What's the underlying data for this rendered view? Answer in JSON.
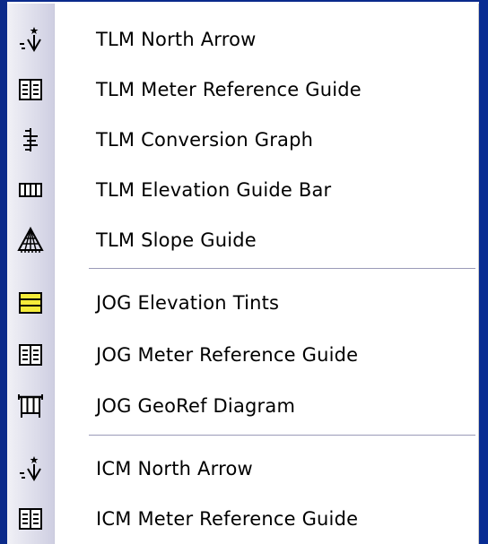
{
  "menu": {
    "groups": [
      {
        "items": [
          {
            "label": "TLM North Arrow",
            "icon": "north-arrow-icon"
          },
          {
            "label": "TLM Meter Reference Guide",
            "icon": "meter-reference-icon"
          },
          {
            "label": "TLM Conversion Graph",
            "icon": "conversion-graph-icon"
          },
          {
            "label": "TLM Elevation Guide Bar",
            "icon": "elevation-guide-bar-icon"
          },
          {
            "label": "TLM Slope Guide",
            "icon": "slope-guide-icon"
          }
        ]
      },
      {
        "items": [
          {
            "label": "JOG Elevation Tints",
            "icon": "elevation-tints-icon"
          },
          {
            "label": "JOG Meter Reference Guide",
            "icon": "meter-reference-icon"
          },
          {
            "label": "JOG GeoRef Diagram",
            "icon": "georef-diagram-icon"
          }
        ]
      },
      {
        "items": [
          {
            "label": "ICM North Arrow",
            "icon": "north-arrow-icon"
          },
          {
            "label": "ICM Meter Reference Guide",
            "icon": "meter-reference-icon"
          }
        ]
      }
    ]
  },
  "colors": {
    "desktop": "#0a2a8c",
    "menu_bg": "#ffffff",
    "tint_yellow": "#f5ec3a"
  }
}
